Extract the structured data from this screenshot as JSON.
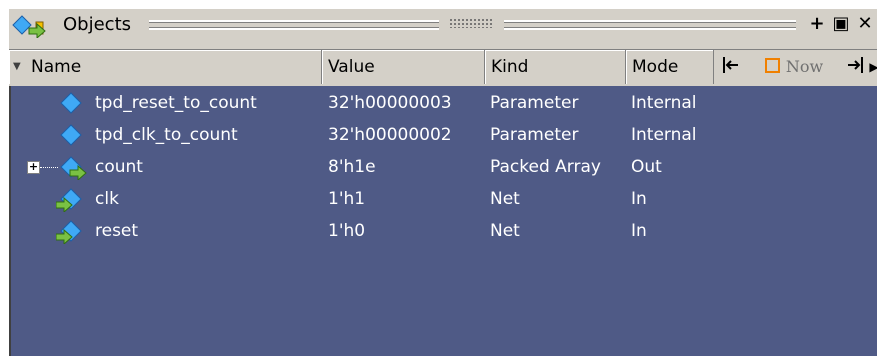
{
  "panel": {
    "title": "Objects",
    "buttons": {
      "add_label": "+",
      "undock_label": "▣",
      "close_label": "✕"
    }
  },
  "columns": {
    "name": "Name",
    "value": "Value",
    "kind": "Kind",
    "mode": "Mode"
  },
  "nav": {
    "now_label": "Now",
    "prev_icon": "jump-prev-icon",
    "next_icon": "jump-next-icon"
  },
  "rows": [
    {
      "name": "tpd_reset_to_count",
      "value": "32'h00000003",
      "kind": "Parameter",
      "mode": "Internal",
      "icon": "parameter-icon",
      "expandable": false
    },
    {
      "name": "tpd_clk_to_count",
      "value": "32'h00000002",
      "kind": "Parameter",
      "mode": "Internal",
      "icon": "parameter-icon",
      "expandable": false
    },
    {
      "name": "count",
      "value": "8'h1e",
      "kind": "Packed Array",
      "mode": "Out",
      "icon": "output-port-icon",
      "expandable": true
    },
    {
      "name": "clk",
      "value": "1'h1",
      "kind": "Net",
      "mode": "In",
      "icon": "input-port-icon",
      "expandable": false
    },
    {
      "name": "reset",
      "value": "1'h0",
      "kind": "Net",
      "mode": "In",
      "icon": "input-port-icon",
      "expandable": false
    }
  ],
  "colors": {
    "list_background": "#4f5a86",
    "text": "#ffffff",
    "chrome": "#d4d0c8",
    "diamond": "#3fa9f5",
    "arrow": "#7ac143"
  }
}
